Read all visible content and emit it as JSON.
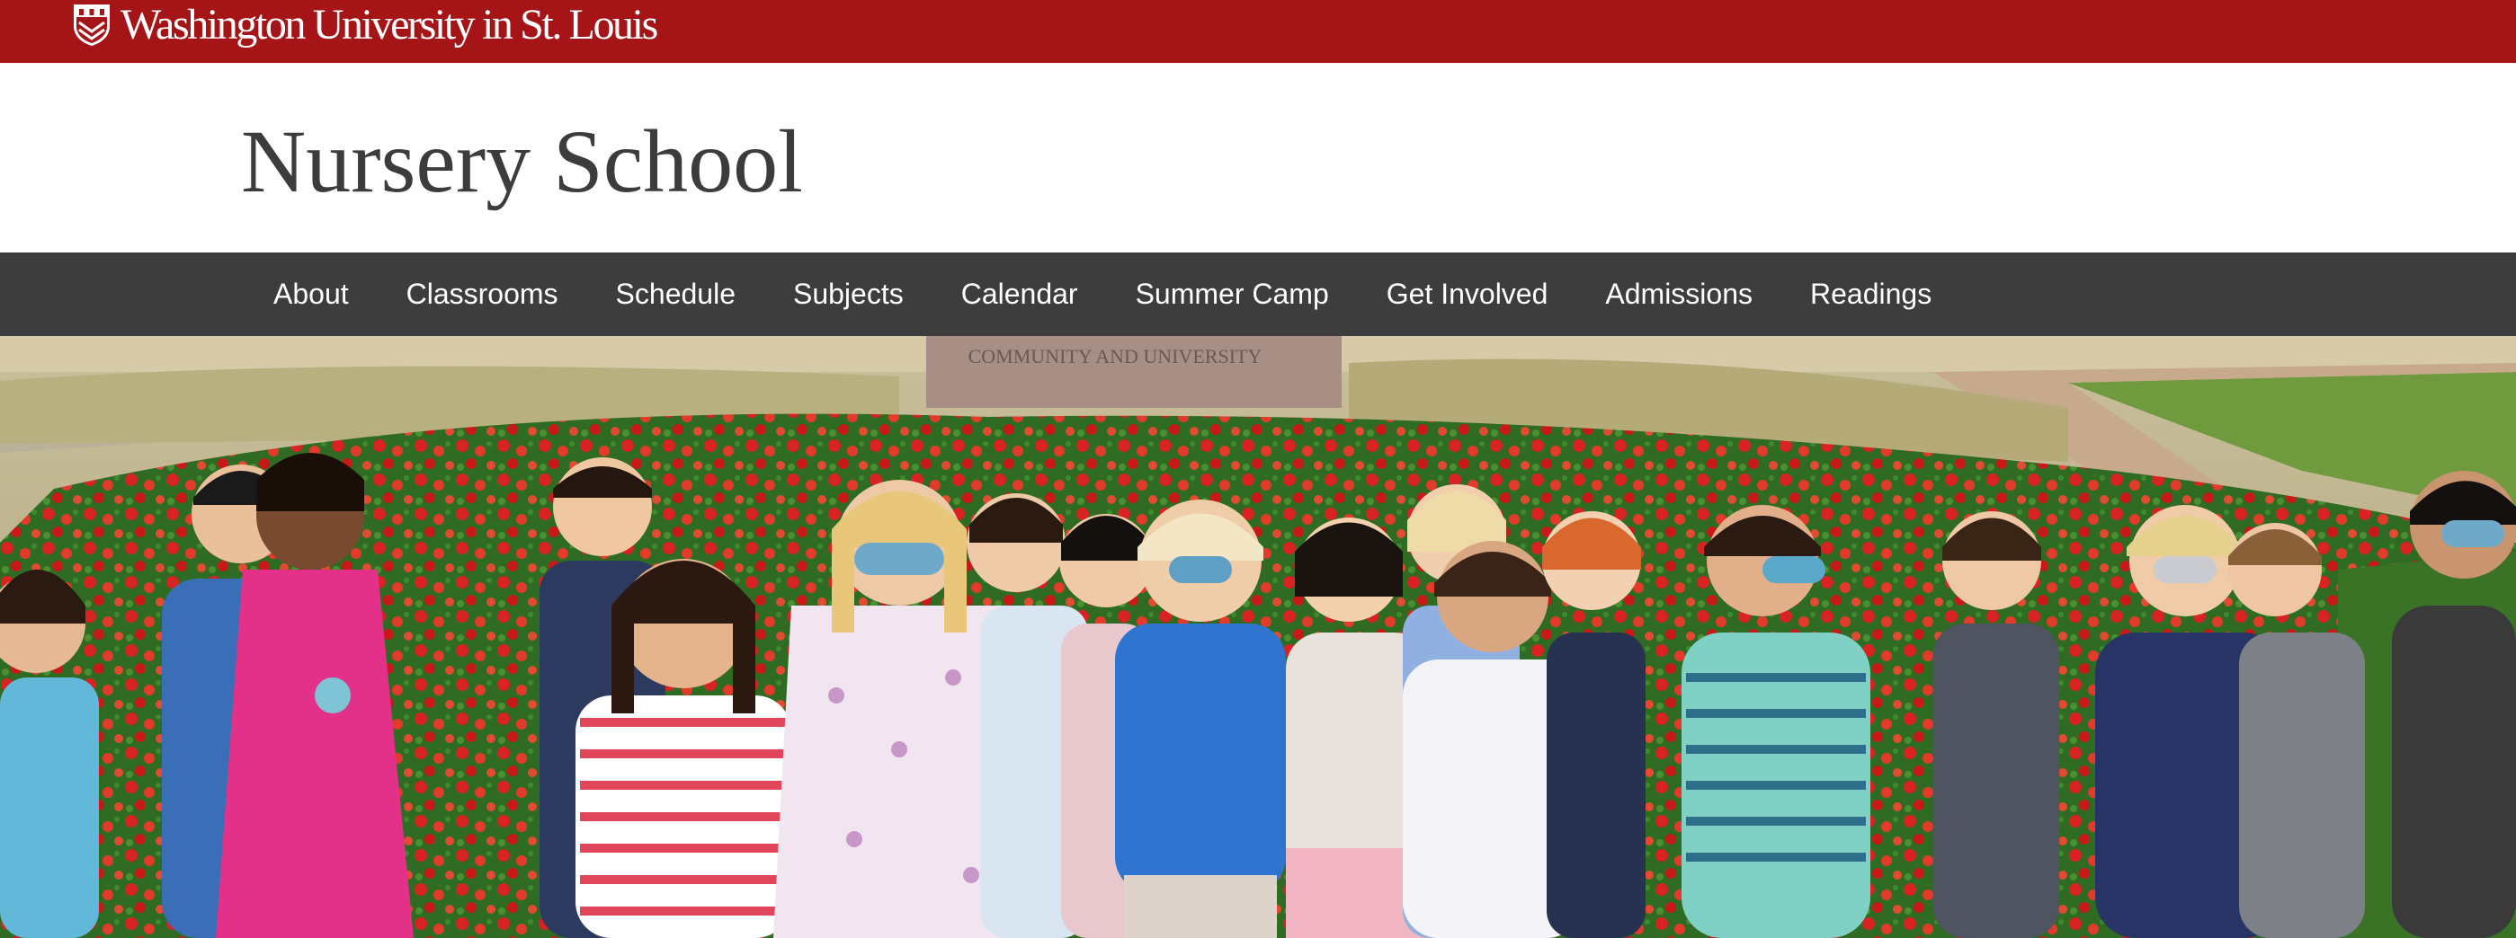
{
  "university": {
    "name": "Washington University in St. Louis",
    "logo_icon": "washu-shield-icon"
  },
  "site": {
    "title": "Nursery School"
  },
  "nav": {
    "items": [
      {
        "label": "About"
      },
      {
        "label": "Classrooms"
      },
      {
        "label": "Schedule"
      },
      {
        "label": "Subjects"
      },
      {
        "label": "Calendar"
      },
      {
        "label": "Summer Camp"
      },
      {
        "label": "Get Involved"
      },
      {
        "label": "Admissions"
      },
      {
        "label": "Readings"
      }
    ]
  },
  "hero": {
    "sign_lines": [
      "COMMUNITY AND UNIVERSITY"
    ]
  },
  "colors": {
    "brand_red": "#a51417",
    "nav_bg": "#3d3d3d",
    "title_text": "#3c3c3c"
  }
}
